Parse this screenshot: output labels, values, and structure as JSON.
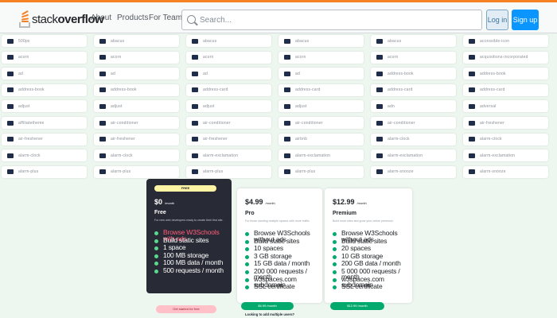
{
  "nav": {
    "logo_light": "stack",
    "logo_bold": "overflow",
    "links": [
      "About",
      "Products",
      "For Teams"
    ],
    "search_placeholder": "Search...",
    "login_label": "Log in",
    "signup_label": "Sign up",
    "accent": "#f48225"
  },
  "icon_grid": [
    [
      "500px",
      "abacus",
      "abacus",
      "abacus",
      "abacus",
      "accessible-icon"
    ],
    [
      "acorn",
      "acorn",
      "acorn",
      "acorn",
      "acorn",
      "acquisitions-incorporated"
    ],
    [
      "ad",
      "ad",
      "ad",
      "ad",
      "address-book",
      "address-book"
    ],
    [
      "address-book",
      "address-book",
      "address-card",
      "address-card",
      "address-card",
      "address-card"
    ],
    [
      "adjust",
      "adjust",
      "adjust",
      "adjust",
      "adn",
      "adversal"
    ],
    [
      "affiliatetheme",
      "air-conditioner",
      "air-conditioner",
      "air-conditioner",
      "air-conditioner",
      "air-freshener"
    ],
    [
      "air-freshener",
      "air-freshener",
      "air-freshener",
      "airbnb",
      "alarm-clock",
      "alarm-clock"
    ],
    [
      "alarm-clock",
      "alarm-clock",
      "alarm-exclamation",
      "alarm-exclamation",
      "alarm-exclamation",
      "alarm-exclamation"
    ],
    [
      "alarm-plus",
      "alarm-plus",
      "alarm-plus",
      "alarm-plus",
      "alarm-snooze",
      "alarm-snooze"
    ]
  ],
  "pricing": {
    "free": {
      "badge": "FREE",
      "price": "$0",
      "per": "/month",
      "name": "Free",
      "desc": "For new web developers ready to create their first site.",
      "features": [
        "Browse W3Schools with ads",
        "Build static sites",
        "1 space",
        "100 MB storage",
        "100 MB data / month",
        "500 requests / month"
      ],
      "cta": "Get started for free"
    },
    "pro": {
      "price": "$4.99",
      "per": "/month",
      "name": "Pro",
      "desc": "For those wanting multiple spaces with more traffic",
      "features": [
        "Browse W3Schools without ads",
        "Build static sites",
        "10 spaces",
        "3 GB storage",
        "15 GB data / month",
        "200 000 requests / month",
        "w3spaces.com subdomain",
        "SSL certificate"
      ],
      "cta": "$4.99 /month"
    },
    "premium": {
      "price": "$12.99",
      "per": "/month",
      "name": "Premium",
      "desc": "Build more sites and grow your online presence.",
      "features": [
        "Browse W3Schools without ads",
        "Build static sites",
        "20 spaces",
        "10 GB storage",
        "200 GB data / month",
        "5 000 000 requests / month",
        "w3spaces.com subdomain",
        "SSL certificate"
      ],
      "cta": "$12.99 /month"
    },
    "footnote": "Looking to add multiple users?"
  }
}
